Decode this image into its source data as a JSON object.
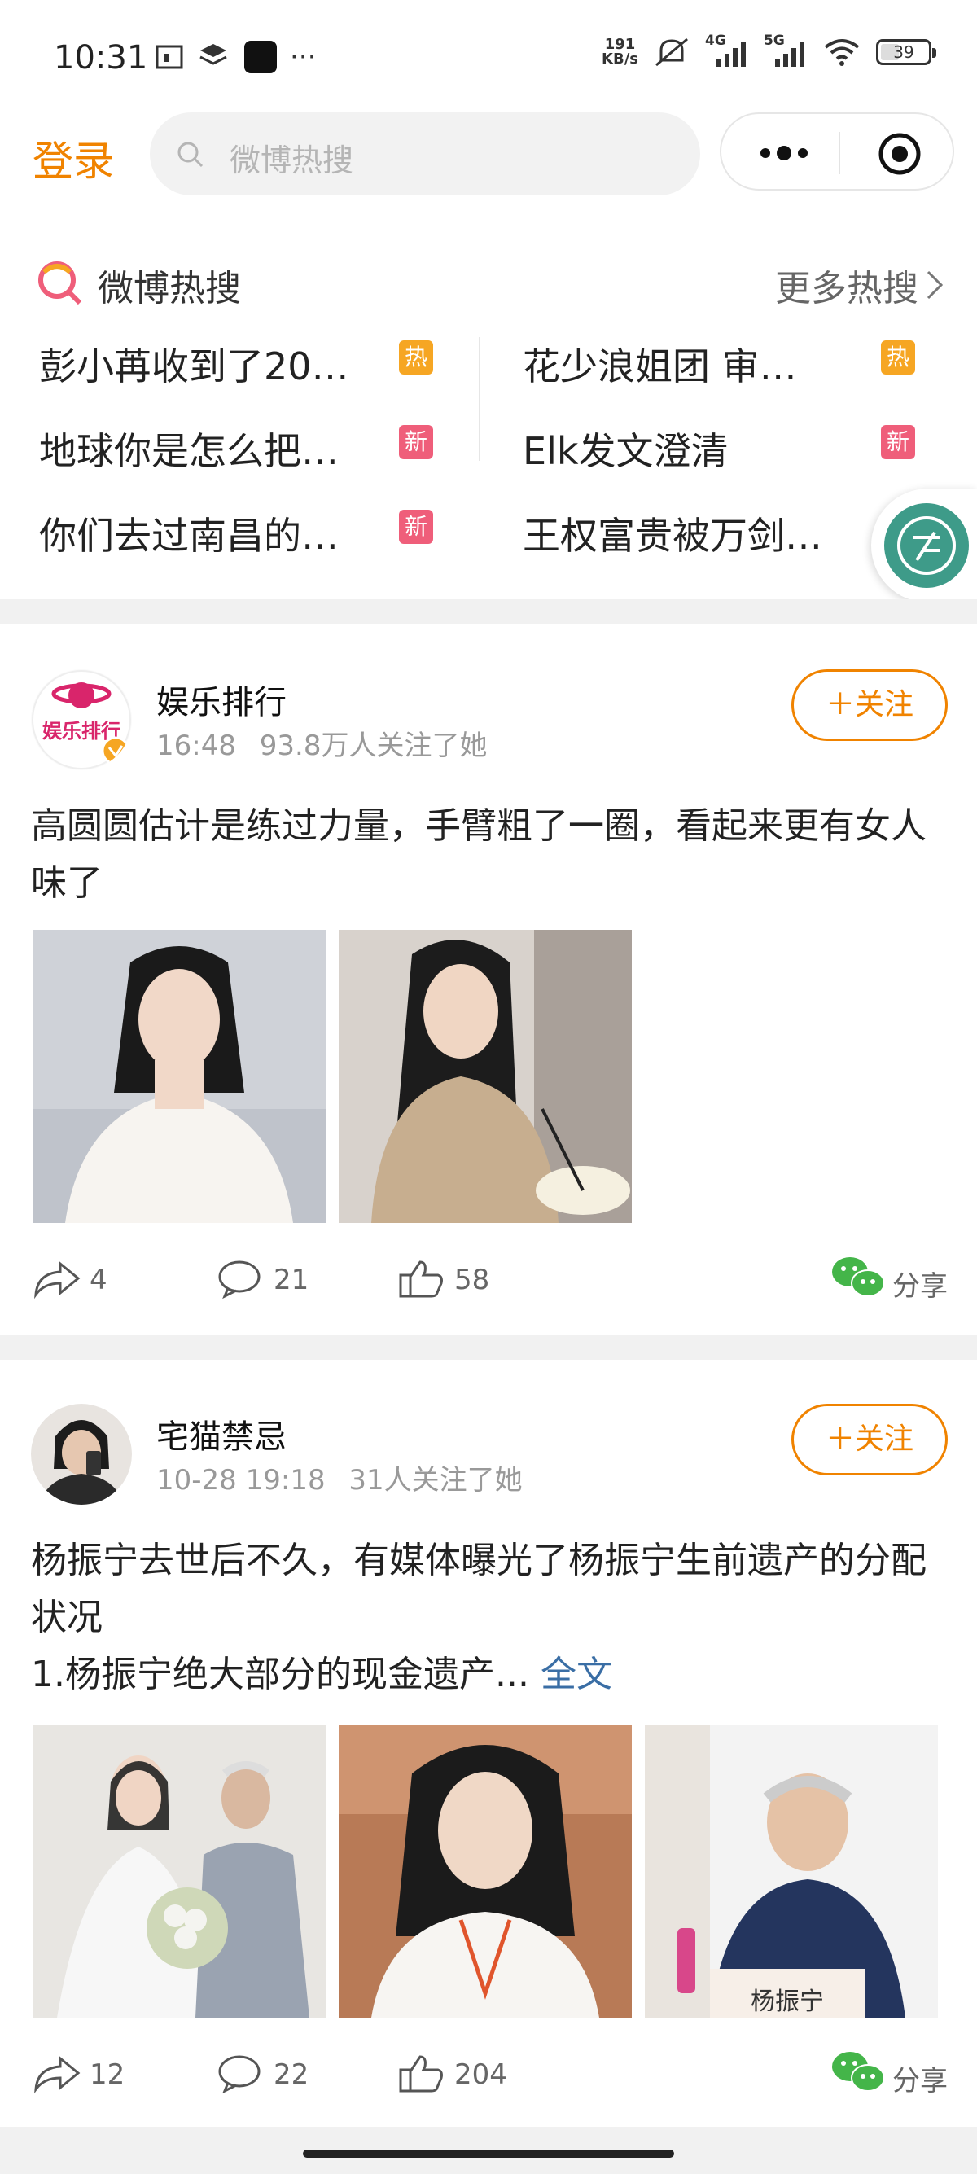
{
  "status_bar": {
    "time": "10:31",
    "net_speed_value": "191",
    "net_speed_unit": "KB/s",
    "net_4g": "4G",
    "net_5g": "5G",
    "battery": "39",
    "battery_level": 0.39
  },
  "header": {
    "login_label": "登录",
    "search_placeholder": "微博热搜"
  },
  "hot_search": {
    "title": "微博热搜",
    "more_label": "更多热搜",
    "items": [
      {
        "text": "彭小苒收到了20…",
        "badge": "热",
        "badge_color": "#f6a623"
      },
      {
        "text": "花少浪姐团 审…",
        "badge": "热",
        "badge_color": "#f6a623"
      },
      {
        "text": "地球你是怎么把…",
        "badge": "新",
        "badge_color": "#ef5e7a"
      },
      {
        "text": "Elk发文澄清",
        "badge": "新",
        "badge_color": "#ef5e7a"
      },
      {
        "text": "你们去过南昌的…",
        "badge": "新",
        "badge_color": "#ef5e7a"
      },
      {
        "text": "王权富贵被万剑…",
        "badge": "",
        "badge_color": ""
      }
    ]
  },
  "posts": [
    {
      "author": "娱乐排行",
      "time": "16:48",
      "followers": "93.8万人关注了她",
      "follow_label": "＋关注",
      "content": "高圆圆估计是练过力量，手臂粗了一圈，看起来更有女人味了",
      "content_more": "",
      "repost": "4",
      "comment": "21",
      "like": "58",
      "share_label": "分享"
    },
    {
      "author": "宅猫禁忌",
      "time": "10-28 19:18",
      "followers": "31人关注了她",
      "follow_label": "＋关注",
      "content": "杨振宁去世后不久，有媒体曝光了杨振宁生前遗产的分配状况\n1.杨振宁绝大部分的现金遗产...",
      "content_more": " 全文",
      "repost": "12",
      "comment": "22",
      "like": "204",
      "share_label": "分享",
      "image_caption": "杨振宁"
    }
  ],
  "colors": {
    "accent": "#f08300",
    "hot_badge": "#f6a623",
    "new_badge": "#ef5e7a",
    "link": "#3a6ea5",
    "wechat_green": "#44b549"
  }
}
